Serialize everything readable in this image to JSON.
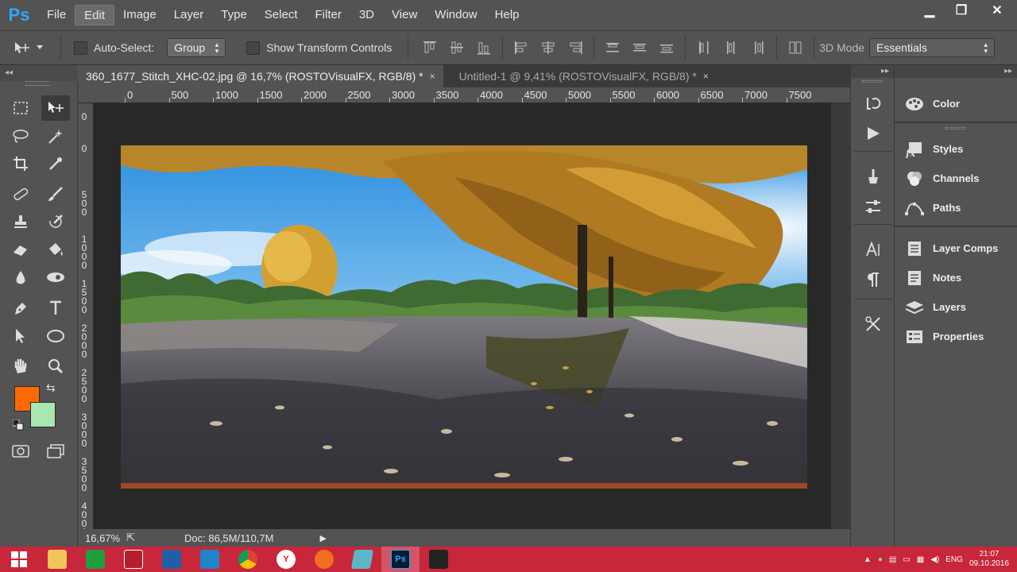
{
  "app": {
    "logo": "Ps"
  },
  "menu": [
    "File",
    "Edit",
    "Image",
    "Layer",
    "Type",
    "Select",
    "Filter",
    "3D",
    "View",
    "Window",
    "Help"
  ],
  "menu_active_index": 1,
  "window_controls": {
    "minimize": "▁",
    "restore": "❐",
    "close": "✕"
  },
  "options": {
    "auto_select_label": "Auto-Select:",
    "auto_select_value": "Group",
    "show_transform_label": "Show Transform Controls",
    "mode_label": "3D Mode",
    "workspace_value": "Essentials"
  },
  "tabs": [
    {
      "label": "360_1677_Stitch_XHC-02.jpg @ 16,7% (ROSTOVisualFX, RGB/8) *",
      "close": "×"
    },
    {
      "label": "Untitled-1 @ 9,41% (ROSTOVisualFX, RGB/8) *",
      "close": "×"
    }
  ],
  "ruler_top": [
    "0",
    "500",
    "1000",
    "1500",
    "2000",
    "2500",
    "3000",
    "3500",
    "4000",
    "4500",
    "5000",
    "5500",
    "6000",
    "6500",
    "7000",
    "7500"
  ],
  "ruler_left": [
    "0",
    "0",
    "5\n0\n0",
    "1\n0\n0\n0",
    "1\n5\n0\n0",
    "2\n0\n0\n0",
    "2\n5\n0\n0",
    "3\n0\n0\n0",
    "3\n5\n0\n0",
    "4\n0\n0\n0"
  ],
  "status": {
    "zoom": "16,67%",
    "doc": "Doc: 86,5M/110,7M"
  },
  "panels": {
    "groups": [
      [
        "Color"
      ],
      [
        "Styles",
        "Channels",
        "Paths"
      ],
      [
        "Layer Comps",
        "Notes",
        "Layers",
        "Properties"
      ]
    ]
  },
  "colors": {
    "foreground": "#ff6a00",
    "background": "#a8e8b0",
    "taskbar": "#c8263a",
    "ps_blue": "#31a8ff"
  },
  "tray": {
    "lang": "ENG",
    "time": "21:07",
    "date": "09.10.2016"
  }
}
